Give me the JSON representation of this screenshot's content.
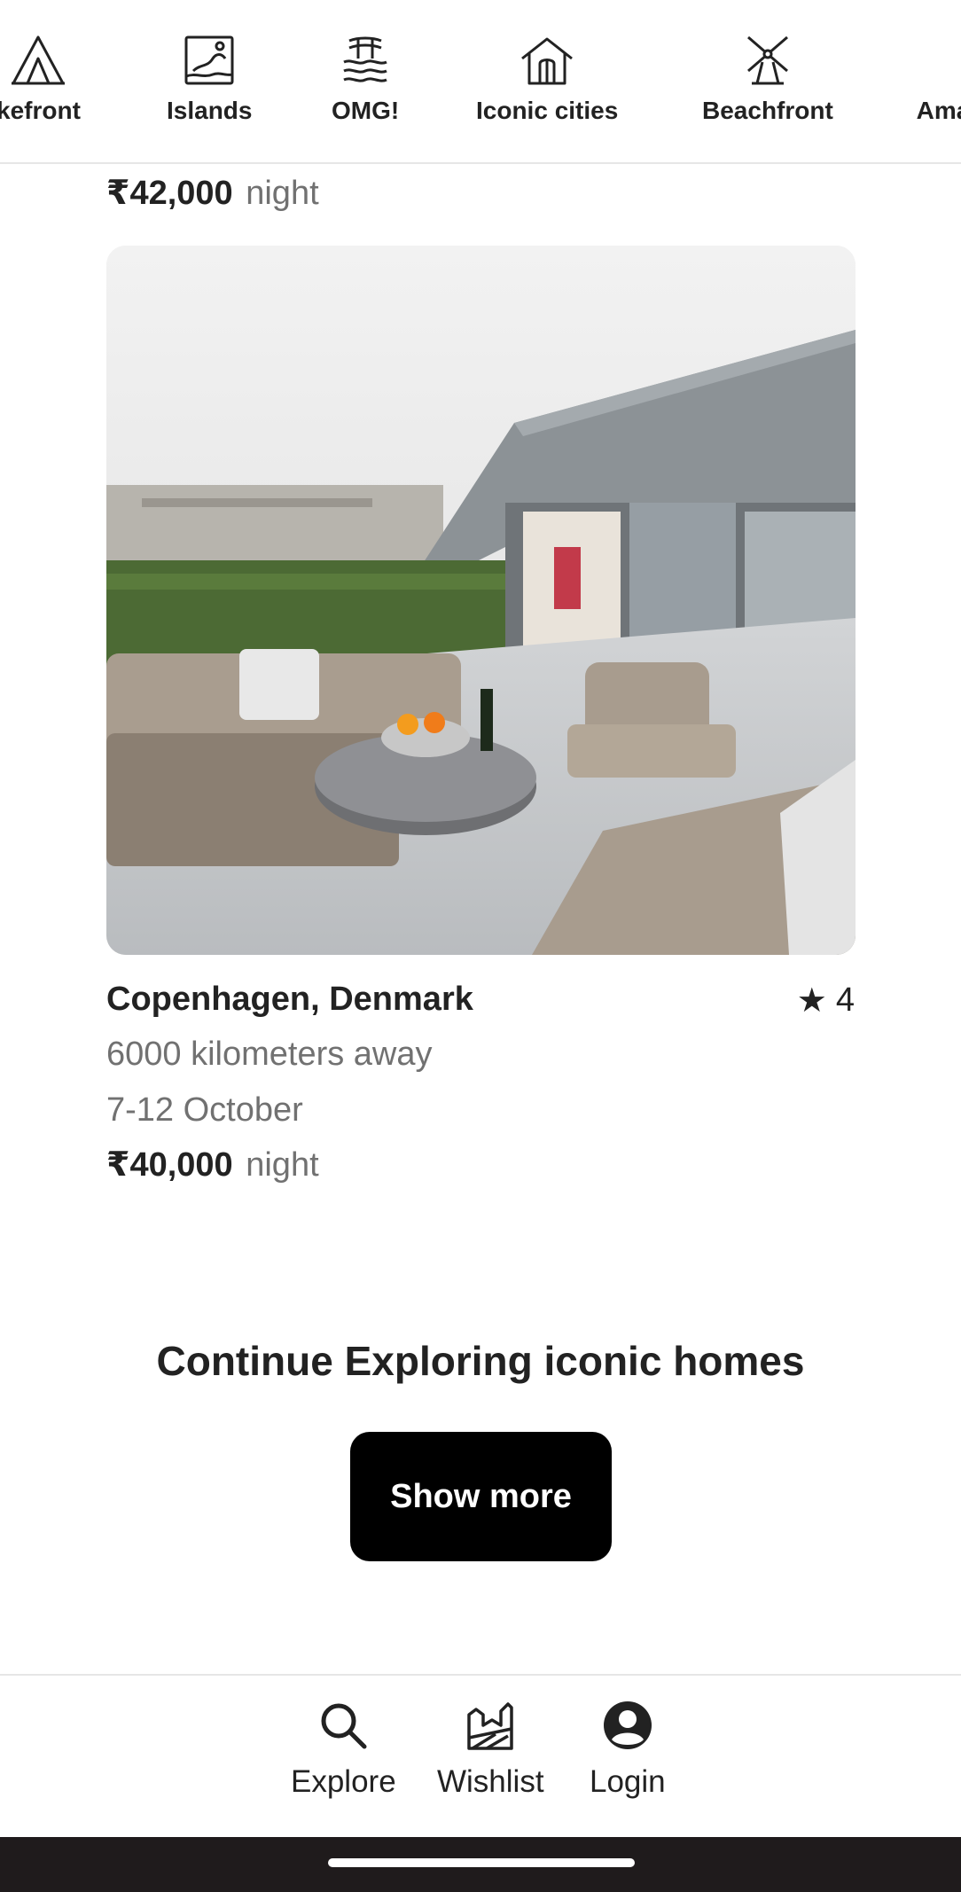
{
  "categories": [
    {
      "label": "kefront",
      "icon": "a-frame-cabin-icon"
    },
    {
      "label": "Islands",
      "icon": "island-map-icon"
    },
    {
      "label": "OMG!",
      "icon": "omg-house-icon"
    },
    {
      "label": "Iconic cities",
      "icon": "iconic-cities-icon"
    },
    {
      "label": "Beachfront",
      "icon": "windmill-icon"
    },
    {
      "label": "Ama"
    }
  ],
  "previous_listing": {
    "price": "₹42,000",
    "unit": "night"
  },
  "listing": {
    "location": "Copenhagen, Denmark",
    "rating": "4",
    "distance": "6000 kilometers away",
    "dates": "7-12 October",
    "price": "₹40,000",
    "unit": "night"
  },
  "continue": {
    "heading": "Continue Exploring iconic homes",
    "button": "Show more"
  },
  "nav": [
    {
      "label": "Explore",
      "icon": "search-icon"
    },
    {
      "label": "Wishlist",
      "icon": "wishlist-icon"
    },
    {
      "label": "Login",
      "icon": "account-icon"
    }
  ]
}
